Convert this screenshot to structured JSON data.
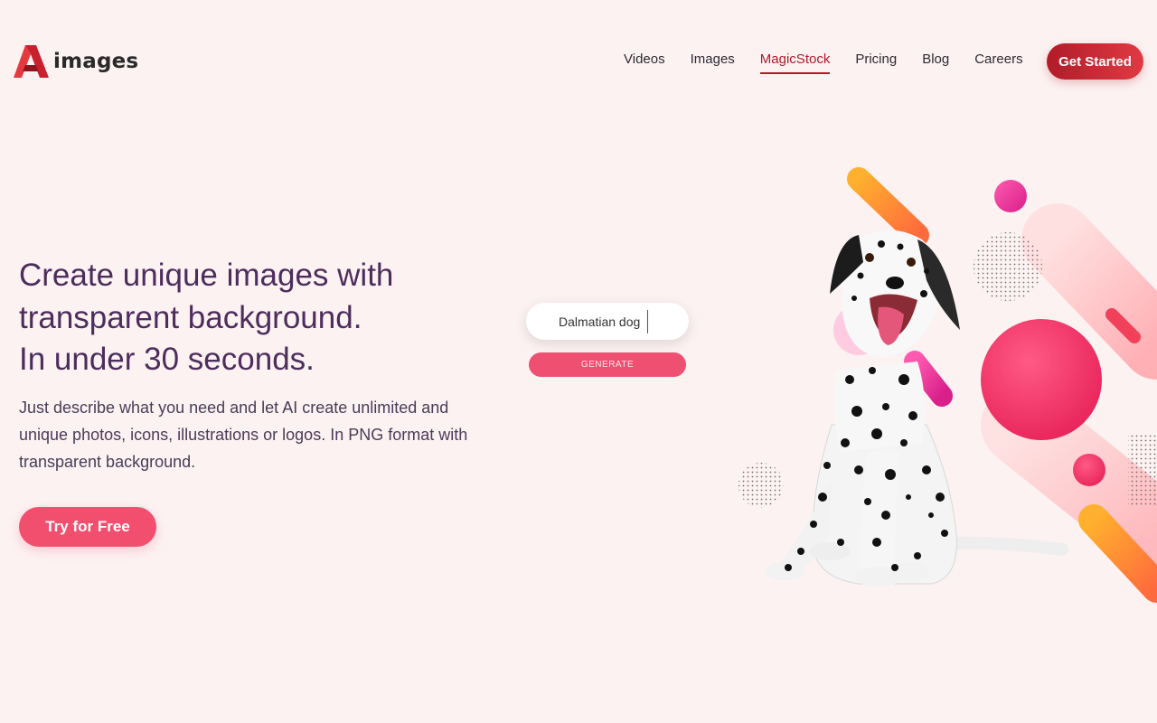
{
  "header": {
    "logo_text": "images",
    "nav": [
      {
        "label": "Videos"
      },
      {
        "label": "Images"
      },
      {
        "label": "MagicStock",
        "active": true
      },
      {
        "label": "Pricing"
      },
      {
        "label": "Blog"
      },
      {
        "label": "Careers"
      }
    ],
    "cta_label": "Get Started"
  },
  "hero": {
    "title_lines": [
      "Create unique images with",
      "transparent background.",
      "In under 30 seconds."
    ],
    "description": "Just describe what you need and let AI create unlimited and unique photos, icons, illustrations or logos. In PNG format with transparent background.",
    "cta_label": "Try for Free"
  },
  "generator": {
    "input_value": "Dalmatian dog",
    "button_label": "GENERATE"
  },
  "illustration": {
    "subject": "dalmatian-dog",
    "icons": [
      "logo-icon"
    ]
  },
  "colors": {
    "background": "#fcf2f2",
    "brand_red": "#b3192a",
    "accent_pink": "#f24e6e",
    "heading": "#4d2d5c"
  }
}
